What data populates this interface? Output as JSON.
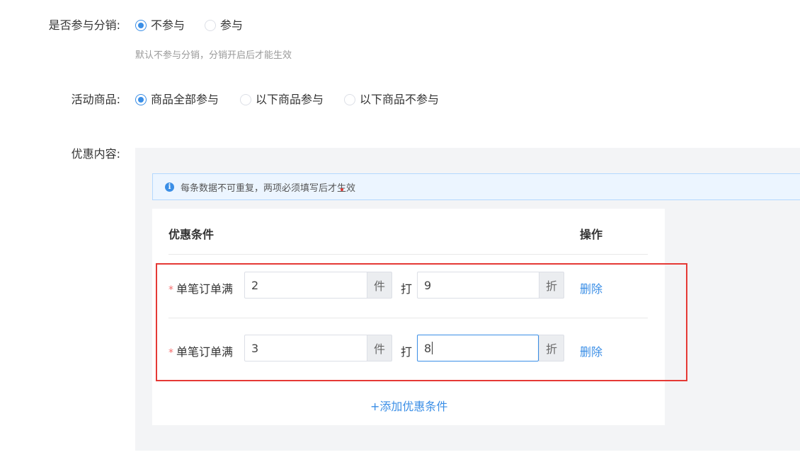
{
  "distribution": {
    "label": "是否参与分销:",
    "options": [
      {
        "label": "不参与",
        "checked": true
      },
      {
        "label": "参与",
        "checked": false
      }
    ],
    "hint": "默认不参与分销，分销开启后才能生效"
  },
  "products": {
    "label": "活动商品:",
    "options": [
      {
        "label": "商品全部参与",
        "checked": true
      },
      {
        "label": "以下商品参与",
        "checked": false
      },
      {
        "label": "以下商品不参与",
        "checked": false
      }
    ]
  },
  "discount": {
    "label": "优惠内容:",
    "alert": "每条数据不可重复，两项必须填写后才生效",
    "alert_icon": "info-icon",
    "table": {
      "col_condition": "优惠条件",
      "col_action": "操作"
    },
    "rows": [
      {
        "required_mark": "*",
        "label": "单笔订单满",
        "qty": "2",
        "qty_unit": "件",
        "mid": "打",
        "discount": "9",
        "discount_unit": "折",
        "delete": "删除"
      },
      {
        "required_mark": "*",
        "label": "单笔订单满",
        "qty": "3",
        "qty_unit": "件",
        "mid": "打",
        "discount": "8",
        "discount_unit": "折",
        "delete": "删除"
      }
    ],
    "add_label": "+添加优惠条件"
  },
  "colors": {
    "primary": "#3a8ee6",
    "highlight_border": "#e53935",
    "required": "#f56c6c"
  }
}
